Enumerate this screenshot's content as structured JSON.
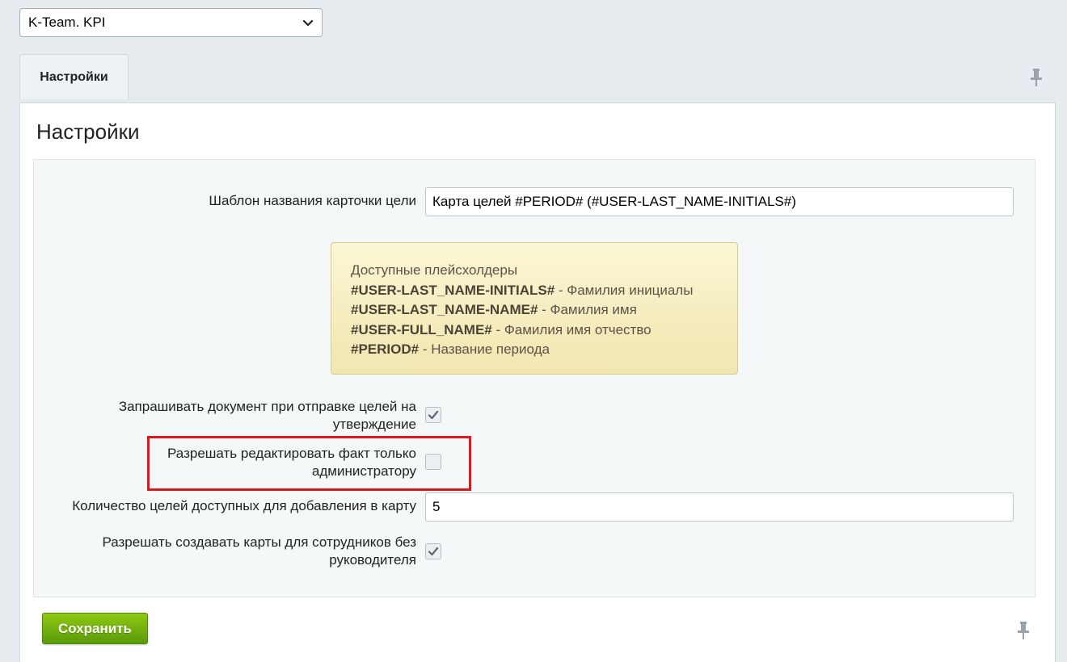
{
  "module_select": {
    "value": "K-Team. KPI"
  },
  "tabs": [
    {
      "label": "Настройки"
    }
  ],
  "page_title": "Настройки",
  "fields": {
    "card_template": {
      "label": "Шаблон названия карточки цели",
      "value": "Карта целей #PERIOD# (#USER-LAST_NAME-INITIALS#)"
    },
    "request_document": {
      "label_line1": "Запрашивать документ при отправке целей на",
      "label_line2": "утверждение",
      "checked": true
    },
    "admin_only_edit": {
      "label_line1": "Разрешать редактировать факт только",
      "label_line2": "администратору",
      "checked": false
    },
    "goals_count": {
      "label": "Количество целей доступных для добавления в карту",
      "value": "5"
    },
    "allow_no_manager": {
      "label_line1": "Разрешать создавать карты для сотрудников без",
      "label_line2": "руководителя",
      "checked": true
    }
  },
  "hint": {
    "title": "Доступные плейсхолдеры",
    "items": [
      {
        "placeholder": "#USER-LAST_NAME-INITIALS#",
        "desc": " - Фамилия инициалы"
      },
      {
        "placeholder": "#USER-LAST_NAME-NAME#",
        "desc": " - Фамилия имя"
      },
      {
        "placeholder": "#USER-FULL_NAME#",
        "desc": " - Фамилия имя отчество"
      },
      {
        "placeholder": "#PERIOD#",
        "desc": " - Название периода"
      }
    ]
  },
  "actions": {
    "save_label": "Сохранить"
  },
  "colors": {
    "save_button": "#6aad0c",
    "highlight": "#e0161c",
    "hint_background": "#f6eec4"
  },
  "icons": {
    "select_chevron": "chevron-down-icon",
    "pin": "pin-icon",
    "check": "checkmark-icon"
  }
}
